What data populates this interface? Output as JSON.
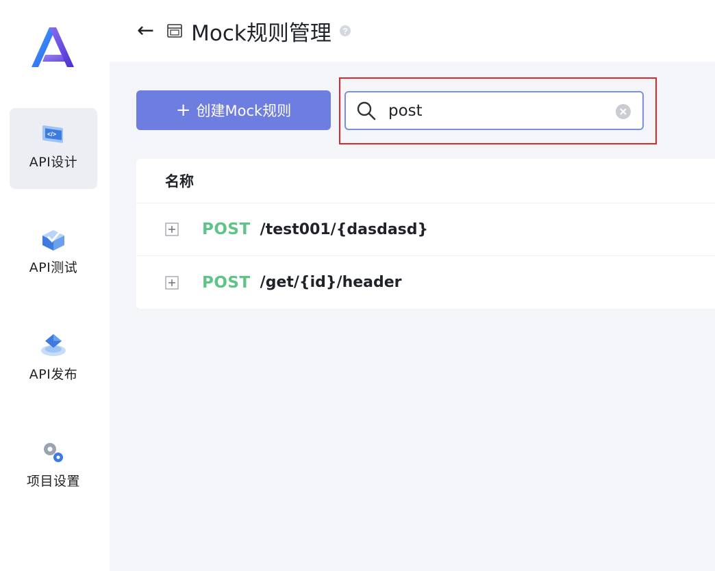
{
  "sidebar": {
    "items": [
      {
        "label": "API设计",
        "icon": "api-design-icon",
        "active": true
      },
      {
        "label": "API测试",
        "icon": "api-test-icon",
        "active": false
      },
      {
        "label": "API发布",
        "icon": "api-publish-icon",
        "active": false
      },
      {
        "label": "项目设置",
        "icon": "project-settings-icon",
        "active": false
      }
    ]
  },
  "header": {
    "back_icon": "arrow-left-icon",
    "doc_icon": "mock-document-icon",
    "title": "Mock规则管理",
    "help_icon": "help-icon"
  },
  "toolbar": {
    "create_plus": "+",
    "create_label": "创建Mock规则",
    "search_value": "post",
    "search_icon": "search-icon",
    "clear_icon": "clear-icon"
  },
  "table": {
    "column_name": "名称",
    "rows": [
      {
        "method": "POST",
        "path": "/test001/{dasdasd}"
      },
      {
        "method": "POST",
        "path": "/get/{id}/header"
      }
    ]
  },
  "colors": {
    "accent": "#6e7ee0",
    "method_post": "#5ec486",
    "highlight": "#e5232b"
  }
}
